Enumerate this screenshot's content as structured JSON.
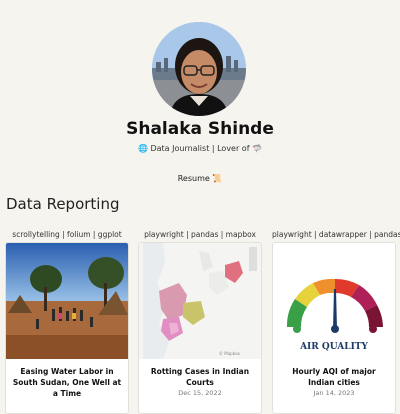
{
  "profile": {
    "name": "Shalaka Shinde",
    "tagline_icon": "🌐",
    "tagline": "Data Journalist | Lover of",
    "tagline_icon2": "🦈",
    "resume_label": "Resume",
    "resume_icon": "📜"
  },
  "sections": {
    "data_reporting": "Data Reporting"
  },
  "cards": [
    {
      "tags": "scrollytelling | folium | ggplot",
      "title": "Easing Water Labor in South Sudan, One Well at a Time",
      "date": ""
    },
    {
      "tags": "playwright | pandas | mapbox",
      "title": "Rotting Cases in Indian Courts",
      "date": "Dec 15, 2022"
    },
    {
      "tags": "playwright | datawrapper | pandas",
      "title": "Hourly AQI of major Indian cities",
      "date": "Jan 14, 2023",
      "image_caption": "AIR QUALITY"
    }
  ],
  "colors": {
    "background": "#f6f4ef",
    "card_background": "#ffffff"
  }
}
